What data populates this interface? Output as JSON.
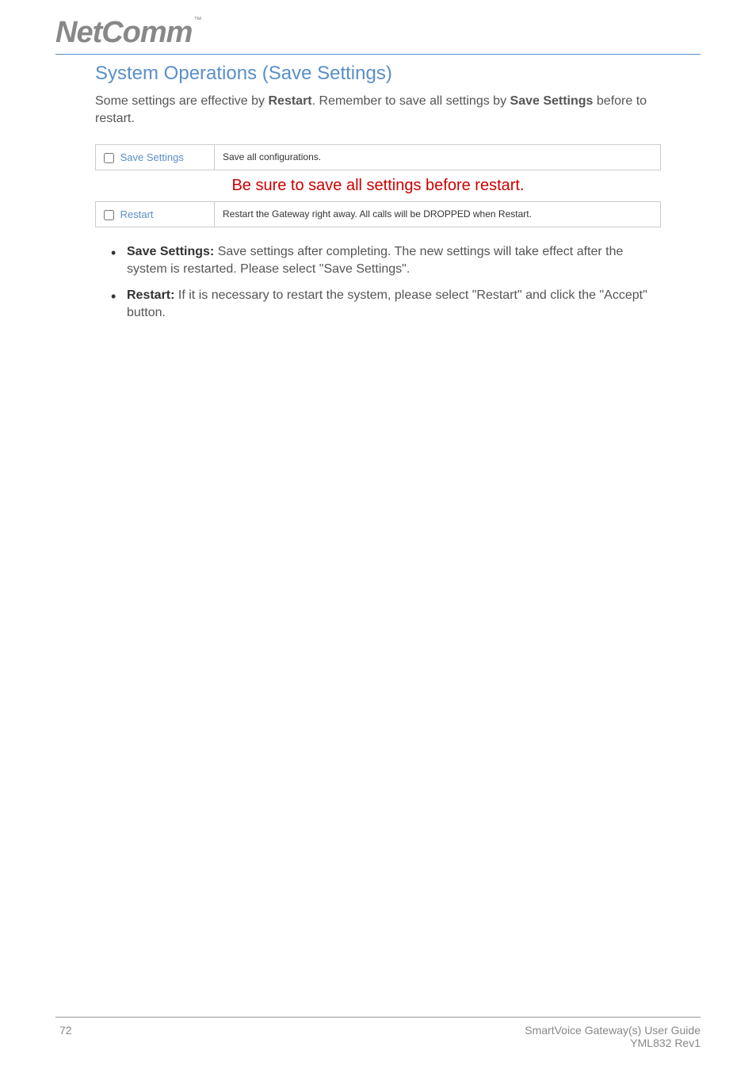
{
  "header": {
    "logo_text": "NetComm",
    "logo_tm": "™"
  },
  "section": {
    "title": "System Operations (Save Settings)",
    "intro_part1": "Some settings are effective by ",
    "intro_bold1": "Restart",
    "intro_part2": ". Remember to save all settings by ",
    "intro_bold2": "Save Settings",
    "intro_part3": " before to restart."
  },
  "table": {
    "row1": {
      "checkbox_label": "Save Settings",
      "description": "Save all configurations."
    },
    "warning": "Be sure to save all settings before restart.",
    "row2": {
      "checkbox_label": "Restart",
      "description": "Restart the Gateway right away. All calls will be DROPPED when Restart."
    }
  },
  "bullets": {
    "item1": {
      "bold": "Save Settings:",
      "text": " Save settings after completing. The new settings will take effect after the system is restarted. Please select \"Save Settings\"."
    },
    "item2": {
      "bold": "Restart:",
      "text": " If it is necessary to restart the system, please select \"Restart\" and click the \"Accept\" button."
    }
  },
  "footer": {
    "page": "72",
    "guide_title": "SmartVoice Gateway(s) User Guide",
    "rev": "YML832 Rev1"
  }
}
